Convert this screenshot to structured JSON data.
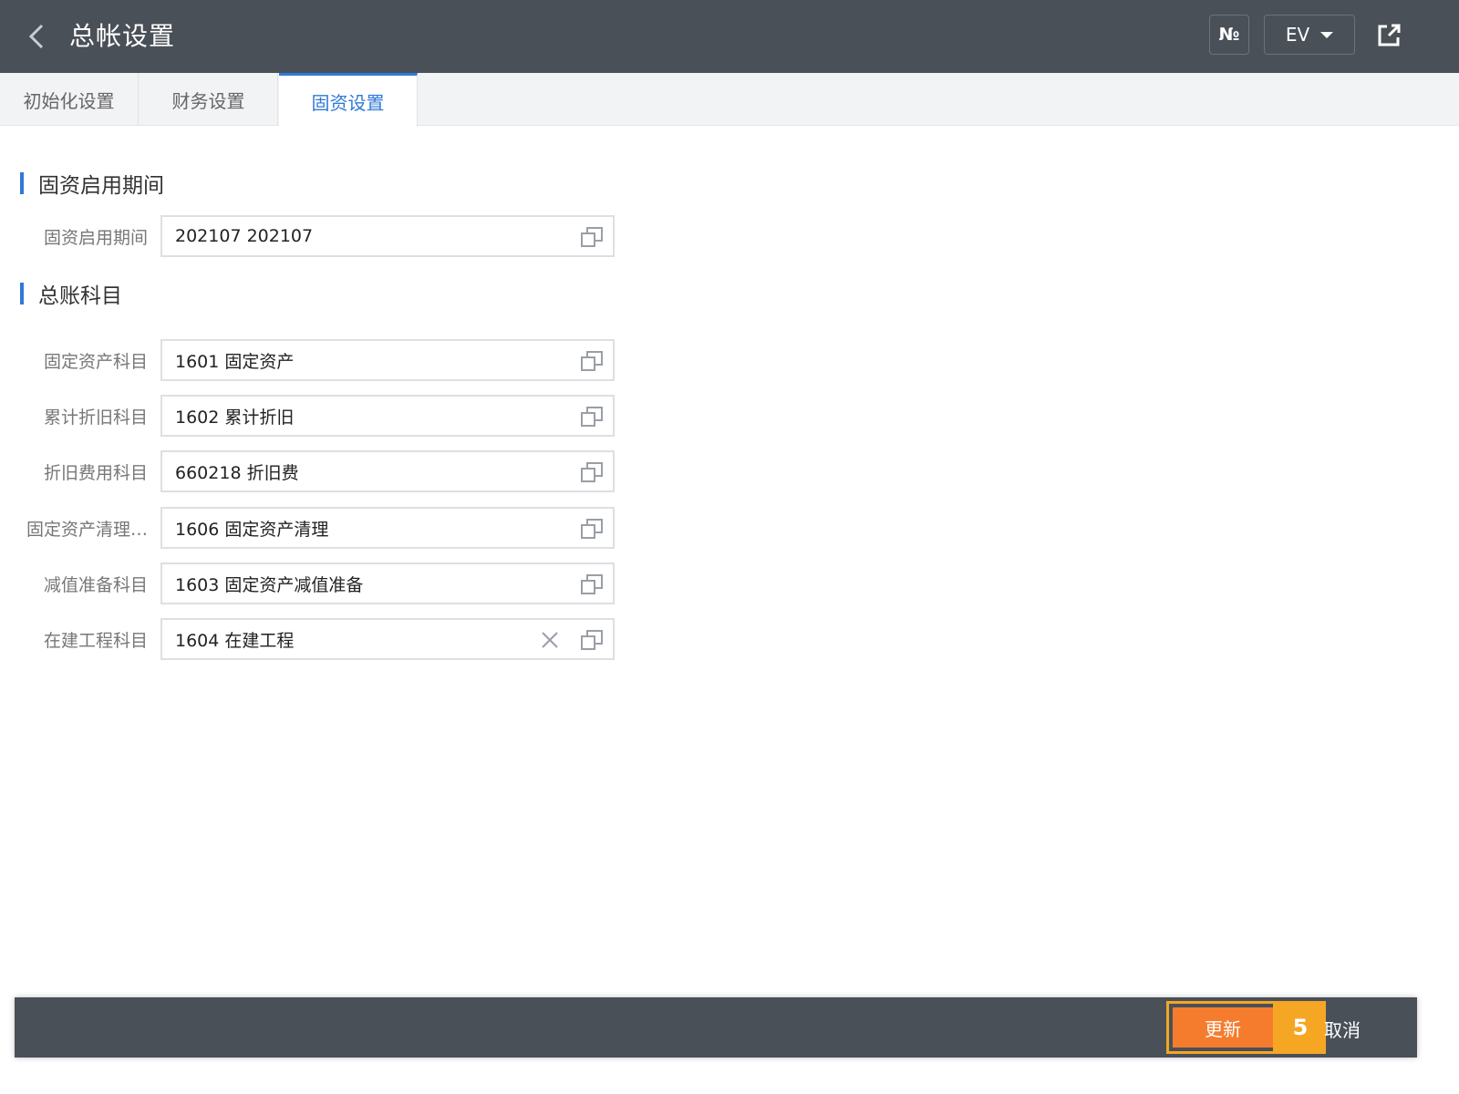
{
  "header": {
    "title": "总帐设置",
    "no_button_label": "№",
    "ev_button_label": "EV"
  },
  "tabs": [
    {
      "label": "初始化设置",
      "active": false
    },
    {
      "label": "财务设置",
      "active": false
    },
    {
      "label": "固资设置",
      "active": true
    }
  ],
  "sections": {
    "asset_period": {
      "title": "固资启用期间",
      "fields": [
        {
          "label": "固资启用期间",
          "value": "202107 202107"
        }
      ]
    },
    "gl_accounts": {
      "title": "总账科目",
      "fields": [
        {
          "label": "固定资产科目",
          "value": "1601 固定资产"
        },
        {
          "label": "累计折旧科目",
          "value": "1602 累计折旧"
        },
        {
          "label": "折旧费用科目",
          "value": "660218 折旧费"
        },
        {
          "label": "固定资产清理…",
          "value": "1606 固定资产清理"
        },
        {
          "label": "减值准备科目",
          "value": "1603 固定资产减值准备"
        },
        {
          "label": "在建工程科目",
          "value": "1604 在建工程"
        }
      ]
    }
  },
  "footer": {
    "update_label": "更新",
    "badge": "5",
    "cancel_label": "取消"
  },
  "colors": {
    "header_bg": "#4a5058",
    "accent_blue": "#2f7ad6",
    "update_orange": "#f57c2d",
    "highlight_yellow": "#f5a623"
  },
  "icons": [
    "back-icon",
    "share-icon",
    "copy-icon",
    "clear-icon",
    "caret-down-icon"
  ]
}
